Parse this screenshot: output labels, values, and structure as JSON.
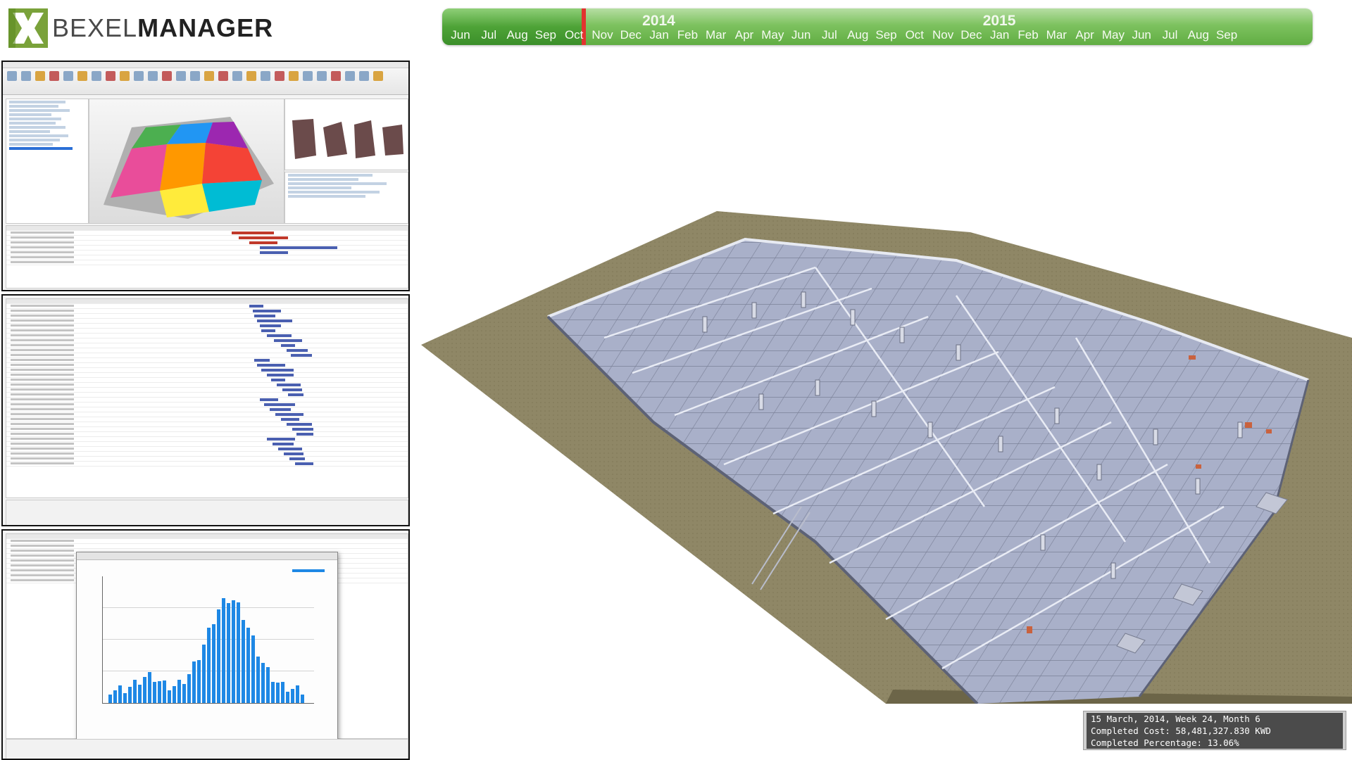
{
  "logo": {
    "light": "BEXEL",
    "bold": "MANAGER"
  },
  "timeline": {
    "years": [
      {
        "label": "2014",
        "index": 7
      },
      {
        "label": "2015",
        "index": 19
      }
    ],
    "months": [
      "Jun",
      "Jul",
      "Aug",
      "Sep",
      "Oct",
      "Nov",
      "Dec",
      "Jan",
      "Feb",
      "Mar",
      "Apr",
      "May",
      "Jun",
      "Jul",
      "Aug",
      "Sep",
      "Oct",
      "Nov",
      "Dec",
      "Jan",
      "Feb",
      "Mar",
      "Apr",
      "May",
      "Jun",
      "Jul",
      "Aug",
      "Sep"
    ],
    "current_progress": 0.163,
    "colors": {
      "bar": "#6fbb52",
      "played": "#4ea337",
      "marker": "#e2332f"
    }
  },
  "status": {
    "date_line": "15 March, 2014, Week 24, Month 6",
    "cost_line": "Completed Cost: 58,481,327.830 KWD",
    "percent_line": "Completed Percentage: 13.06%"
  },
  "icons": {
    "logo": "bexel-x-logo-icon"
  },
  "colors": {
    "accent": "#6fbb52",
    "gantt_bar": "#4a5fb0",
    "histogram": "#1e88e5",
    "model_slab": "#a9b0c9",
    "ground": "#8f8766"
  }
}
